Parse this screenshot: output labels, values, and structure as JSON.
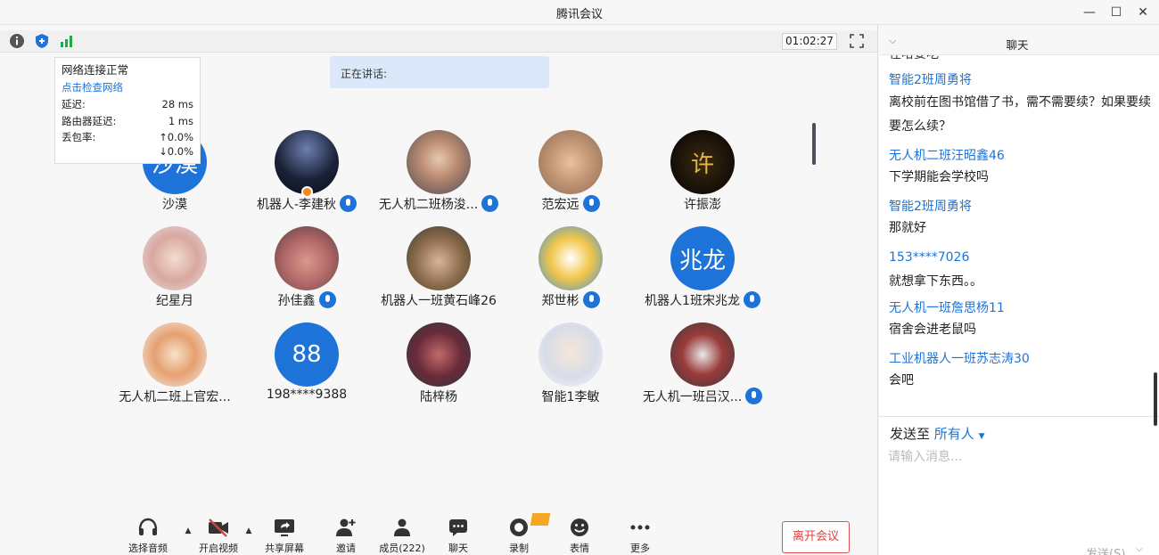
{
  "window": {
    "title": "腾讯会议"
  },
  "toolbar": {
    "timer": "01:02:27"
  },
  "network": {
    "status": "网络连接正常",
    "check_link": "点击检查网络",
    "latency_label": "延迟:",
    "latency_value": "28 ms",
    "router_label": "路由器延迟:",
    "router_value": "1 ms",
    "loss_label": "丢包率:",
    "loss_up": "↑0.0%",
    "loss_down": "↓0.0%"
  },
  "speaking": {
    "label": "正在讲话:"
  },
  "participants": [
    {
      "name": "沙漠",
      "avatar_text": "沙漠",
      "mic": false
    },
    {
      "name": "机器人-李建秋",
      "avatar_text": "",
      "mic": true
    },
    {
      "name": "无人机二班杨浚...",
      "avatar_text": "",
      "mic": true
    },
    {
      "name": "范宏远",
      "avatar_text": "",
      "mic": true
    },
    {
      "name": "许振澎",
      "avatar_text": "许",
      "mic": false
    },
    {
      "name": "纪星月",
      "avatar_text": "",
      "mic": false
    },
    {
      "name": "孙佳鑫",
      "avatar_text": "",
      "mic": true
    },
    {
      "name": "机器人一班黄石峰26",
      "avatar_text": "",
      "mic": false
    },
    {
      "name": "郑世彬",
      "avatar_text": "",
      "mic": true
    },
    {
      "name": "机器人1班宋兆龙",
      "avatar_text": "兆龙",
      "mic": true
    },
    {
      "name": "无人机二班上官宏...",
      "avatar_text": "",
      "mic": false
    },
    {
      "name": "198****9388",
      "avatar_text": "88",
      "mic": false
    },
    {
      "name": "陆梓杨",
      "avatar_text": "",
      "mic": false
    },
    {
      "name": "智能1李敏",
      "avatar_text": "",
      "mic": false
    },
    {
      "name": "无人机一班吕汉...",
      "avatar_text": "",
      "mic": true
    }
  ],
  "bottom": {
    "audio": "选择音频",
    "video": "开启视频",
    "share": "共享屏幕",
    "invite": "邀请",
    "members": "成员(222)",
    "chat": "聊天",
    "record": "录制",
    "emoji": "表情",
    "more": "更多",
    "leave": "离开会议"
  },
  "chat": {
    "title": "聊天",
    "partial": "在哈要吃",
    "messages": [
      {
        "sender": "智能2班周勇将",
        "text": "离校前在图书馆借了书，需不需要续？如果要续要怎么续？"
      },
      {
        "sender": "无人机二班汪昭鑫46",
        "text": "下学期能会学校吗"
      },
      {
        "sender": "智能2班周勇将",
        "text": "那就好"
      },
      {
        "sender": "153****7026",
        "text": "就想拿下东西。。"
      },
      {
        "sender": "无人机一班詹思杨11",
        "text": "宿舍会进老鼠吗"
      },
      {
        "sender": "工业机器人一班苏志涛30",
        "text": "会吧"
      }
    ],
    "send_to_label": "发送至",
    "send_to_target": "所有人",
    "input_placeholder": "请输入消息...",
    "send_button": "发送(S)"
  },
  "colors": {
    "accent": "#1e73d8",
    "leave": "#e04040",
    "speaking_bg": "#dbe8f9"
  }
}
